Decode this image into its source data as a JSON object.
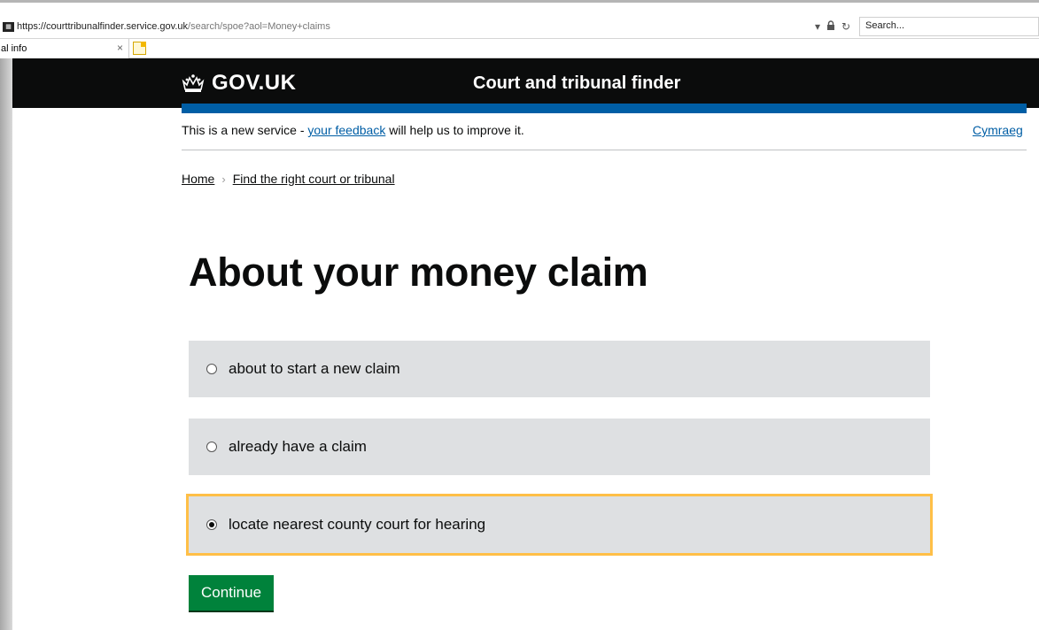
{
  "browser": {
    "url_host": "https://courttribunalfinder.service.gov.uk",
    "url_path": "/search/spoe?aol=Money+claims",
    "search_placeholder": "Search...",
    "tab_title": "al info",
    "tab_close": "×"
  },
  "header": {
    "logo_text": "GOV.UK",
    "service_name": "Court and tribunal finder"
  },
  "phase_banner": {
    "prefix": "This is a new service - ",
    "link": "your feedback",
    "suffix": " will help us to improve it.",
    "language_link": "Cymraeg"
  },
  "breadcrumb": {
    "items": [
      "Home",
      "Find the right court or tribunal"
    ],
    "separator": "›"
  },
  "page": {
    "title": "About your money claim",
    "options": [
      {
        "label": "about to start a new claim",
        "selected": false
      },
      {
        "label": "already have a claim",
        "selected": false
      },
      {
        "label": "locate nearest county court for hearing",
        "selected": true
      }
    ],
    "continue_label": "Continue"
  },
  "colors": {
    "header_bg": "#0b0c0c",
    "accent_blue": "#005ea5",
    "option_bg": "#dee0e2",
    "focus_outline": "#ffbf47",
    "button_green": "#00823b"
  }
}
